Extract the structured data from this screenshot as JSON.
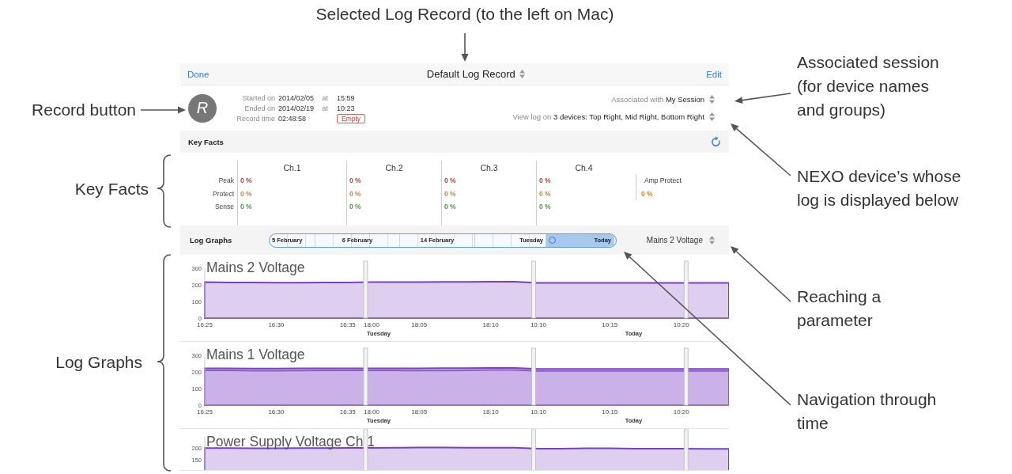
{
  "callouts": [
    {
      "kind": "top",
      "text": "Selected Log Record (to the left on Mac)"
    },
    {
      "kind": "left",
      "text": "Record button"
    },
    {
      "kind": "right",
      "text": "Associated session\n(for device names\nand groups)"
    },
    {
      "kind": "left",
      "text": "Key Facts"
    },
    {
      "kind": "right",
      "text": "NEXO device’s whose\nlog is displayed below"
    },
    {
      "kind": "right",
      "text": "Reaching a\nparameter"
    },
    {
      "kind": "left",
      "text": "Log Graphs"
    },
    {
      "kind": "right",
      "text": "Navigation through\ntime"
    }
  ],
  "app": {
    "nav": {
      "left_button": "Done",
      "title": "Default Log Record",
      "right_button": "Edit"
    },
    "record": {
      "button_label": "R",
      "rows": [
        {
          "kind": "timestamp",
          "label": "Started on",
          "date": "2014/02/05",
          "at": "at",
          "time": "15:59"
        },
        {
          "kind": "timestamp",
          "label": "Ended on",
          "date": "2014/02/19",
          "at": "at",
          "time": "10:23"
        },
        {
          "kind": "duration",
          "label": "Record time",
          "value": "02:48:58",
          "badge": "Empty"
        }
      ]
    },
    "session": "Associated with **My Session**",
    "devices": "View log on **3 devices: Top Right, Mid Right, Bottom Right**",
    "key_facts": {
      "title": "Key Facts",
      "columns": [
        "Ch.1",
        "Ch.2",
        "Ch.3",
        "Ch.4"
      ],
      "rows": [
        {
          "label": "Peak",
          "color": "#c0392b",
          "values": [
            "0 %",
            "0 %",
            "0 %",
            "0 %"
          ]
        },
        {
          "label": "Protect",
          "color": "#c8843c",
          "values": [
            "0 %",
            "0 %",
            "0 %",
            "0 %"
          ]
        },
        {
          "label": "Sense",
          "color": "#4a9a3a",
          "values": [
            "0 %",
            "0 %",
            "0 %",
            "0 %"
          ]
        }
      ],
      "amp_protect": {
        "label": "Amp Protect",
        "value": "0 %",
        "color": "#c8843c"
      }
    },
    "log_graphs": {
      "title": "Log Graphs",
      "timeline": [
        {
          "label": "5 February",
          "selected": false
        },
        {
          "label": "6 February",
          "selected": false
        },
        {
          "label": "14 February",
          "selected": false
        },
        {
          "label": "Tuesday",
          "selected": false
        },
        {
          "label": "Today",
          "selected": true
        }
      ],
      "parameter": "Mains 2 Voltage",
      "graphs": [
        {
          "chart_data": {
            "type": "area",
            "title": "Mains 2 Voltage",
            "categories": [
              "16:25",
              null,
              null,
              "16:30",
              null,
              null,
              "16:35",
              "18:00",
              null,
              "18:05",
              null,
              null,
              "18:10",
              null,
              "10:10",
              null,
              null,
              "10:15",
              null,
              null,
              "10:20",
              null,
              null
            ],
            "series": [
              {
                "color": "#7a3fc4",
                "values": [
                  216,
                  215,
                  214,
                  213,
                  213,
                  214,
                  215,
                  216,
                  217,
                  217,
                  218,
                  218,
                  219,
                  219,
                  212,
                  212,
                  212,
                  212,
                  212,
                  212,
                  212,
                  212,
                  212
                ]
              }
            ],
            "ylim": [
              0,
              300
            ],
            "yticks": [
              0,
              100,
              200,
              300
            ]
          },
          "day_labels": [
            "Tuesday",
            "Today"
          ]
        },
        {
          "chart_data": {
            "type": "area",
            "title": "Mains 1 Voltage",
            "categories": [
              "16:25",
              null,
              null,
              "16:30",
              null,
              null,
              "16:35",
              "18:00",
              null,
              "18:05",
              null,
              null,
              "18:10",
              null,
              "10:10",
              null,
              null,
              "10:15",
              null,
              null,
              "10:20",
              null,
              null
            ],
            "series": [
              {
                "color": "#7a3fc4",
                "values": [
                  222,
                  221,
                  220,
                  220,
                  221,
                  221,
                  222,
                  222,
                  222,
                  222,
                  223,
                  223,
                  224,
                  224,
                  218,
                  218,
                  218,
                  218,
                  218,
                  218,
                  218,
                  218,
                  218
                ]
              },
              {
                "color": "#8e5ad0",
                "values": [
                  210,
                  209,
                  207,
                  207,
                  208,
                  209,
                  210,
                  210,
                  209,
                  208,
                  208,
                  210,
                  212,
                  212,
                  206,
                  206,
                  206,
                  206,
                  206,
                  206,
                  206,
                  206,
                  206
                ]
              }
            ],
            "ylim": [
              0,
              300
            ],
            "yticks": [
              0,
              100,
              200,
              300
            ]
          },
          "day_labels": [
            "Tuesday",
            "Today"
          ]
        },
        {
          "chart_data": {
            "type": "area",
            "title": "Power Supply Voltage Ch.1",
            "categories": [
              null,
              null,
              null,
              null,
              null,
              null,
              null,
              null,
              null,
              null,
              null,
              null,
              null,
              null,
              null,
              null,
              null,
              null,
              null,
              null,
              null,
              null,
              null
            ],
            "series": [
              {
                "color": "#7a3fc4",
                "values": [
                  200,
                  200,
                  199,
                  199,
                  200,
                  200,
                  201,
                  201,
                  202,
                  203,
                  203,
                  202,
                  202,
                  202,
                  198,
                  198,
                  199,
                  199,
                  198,
                  198,
                  198,
                  197,
                  197
                ]
              }
            ],
            "ylim": [
              100,
              250
            ],
            "yticks": [
              150,
              200
            ]
          }
        }
      ]
    }
  }
}
